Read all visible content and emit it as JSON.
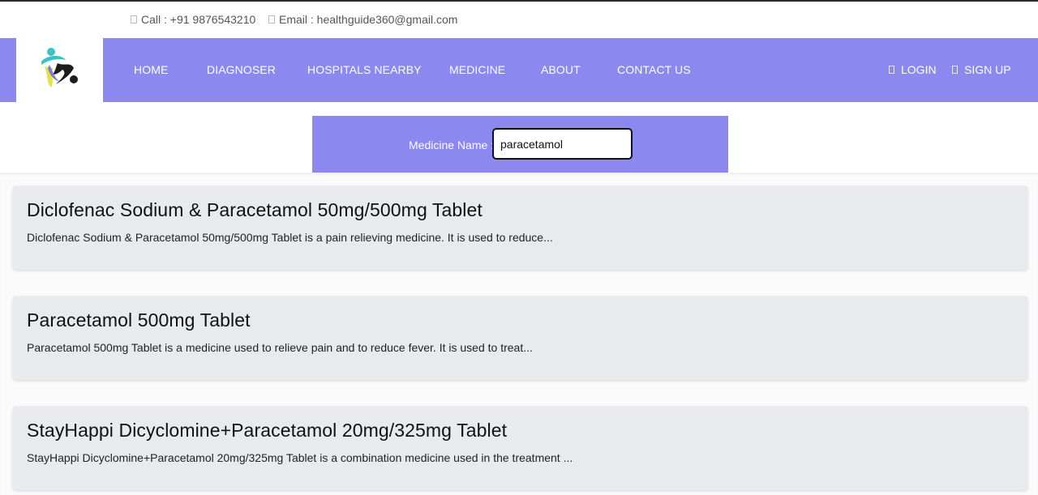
{
  "contact": {
    "call": "Call : +91 9876543210",
    "email": "Email : healthguide360@gmail.com"
  },
  "nav": {
    "links": [
      "HOME",
      "DIAGNOSER",
      "HOSPITALS NEARBY",
      "MEDICINE",
      "ABOUT",
      "CONTACT US"
    ],
    "login": "LOGIN",
    "signup": "SIGN UP"
  },
  "search": {
    "label": "Medicine Name :",
    "value": "paracetamol"
  },
  "results": [
    {
      "title": "Diclofenac Sodium & Paracetamol 50mg/500mg Tablet",
      "description": "Diclofenac Sodium & Paracetamol 50mg/500mg Tablet is a pain relieving medicine. It is used to reduce..."
    },
    {
      "title": "Paracetamol 500mg Tablet",
      "description": "Paracetamol 500mg Tablet is a medicine used to relieve pain and to reduce fever. It is used to treat..."
    },
    {
      "title": "StayHappi Dicyclomine+Paracetamol 20mg/325mg Tablet",
      "description": "StayHappi Dicyclomine+Paracetamol 20mg/325mg Tablet is a combination medicine used in the treatment ..."
    }
  ],
  "icons": {
    "call": "phone-icon",
    "email": "envelope-icon",
    "login": "user-icon",
    "signup": "user-plus-icon",
    "logo": "healthguide-logo"
  },
  "colors": {
    "accent": "#8b89ef",
    "card": "#e8eaed"
  }
}
